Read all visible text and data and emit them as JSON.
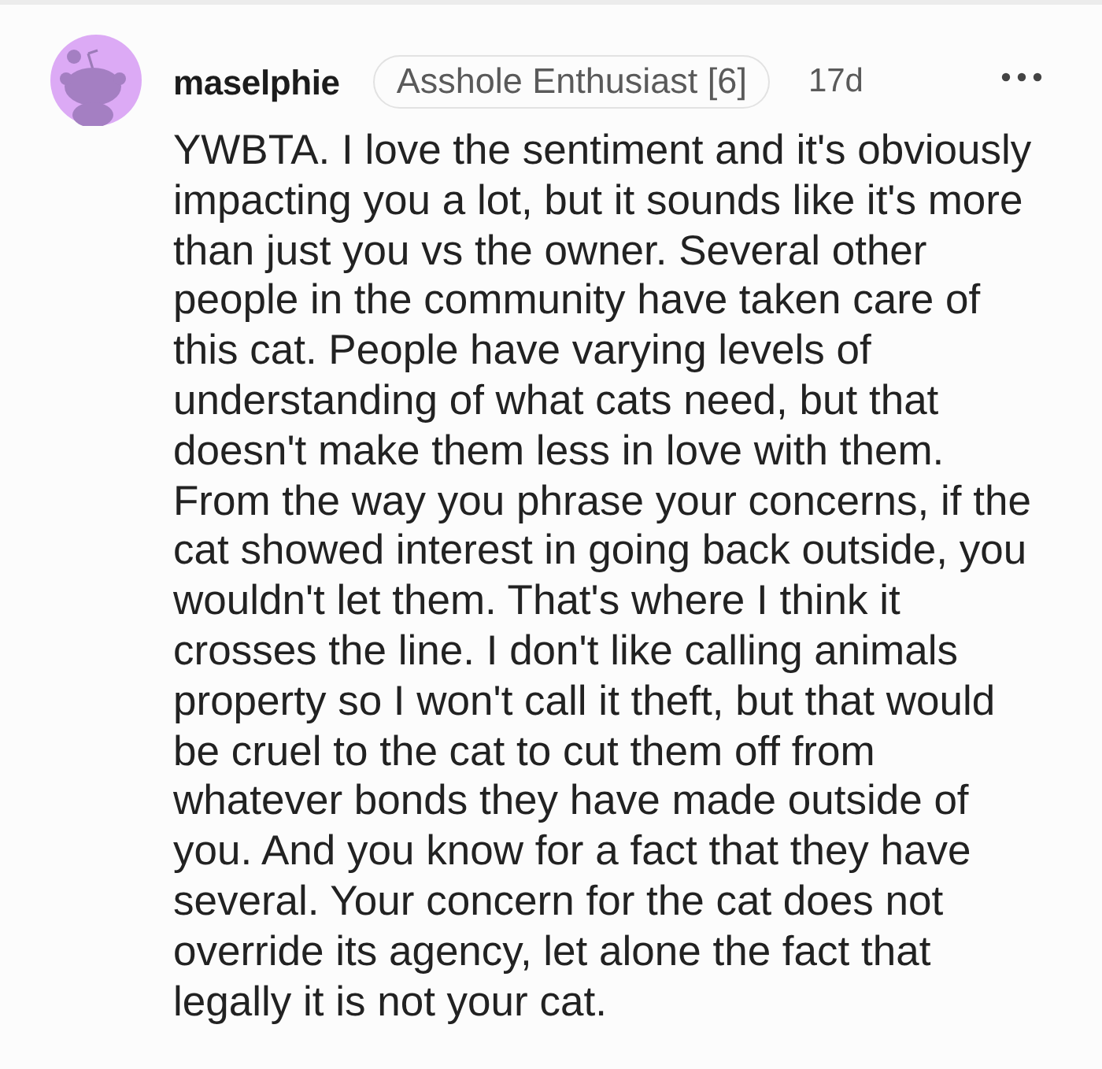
{
  "comment": {
    "author": "maselphie",
    "flair": "Asshole Enthusiast [6]",
    "age": "17d",
    "body": "YWBTA. I love the sentiment and it's obviously impacting you a lot, but it sounds like it's more than just you vs the owner. Several other people in the community have taken care of this cat. People have varying levels of understanding of what cats need, but that doesn't make them less in love with them. From the way you phrase your concerns, if the cat showed interest in going back outside, you wouldn't let them. That's where I think it crosses the line. I don't like calling animals property so I won't call it theft, but that would be cruel to the cat to cut them off from whatever bonds they have made outside of you. And you know for a fact that they have several. Your concern for the cat does not override its agency, let alone the fact that legally it is not your cat."
  }
}
